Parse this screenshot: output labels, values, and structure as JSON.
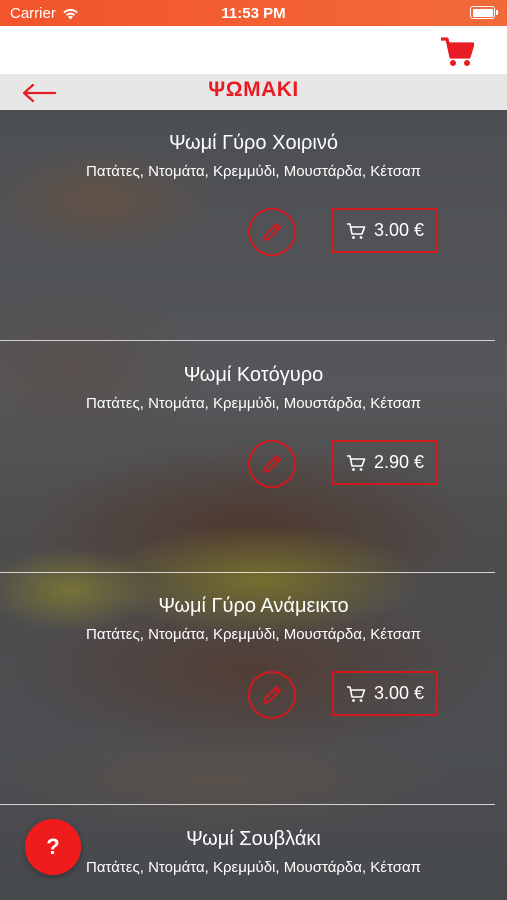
{
  "status_bar": {
    "carrier": "Carrier",
    "time": "11:53 PM",
    "battery_level": 1.0
  },
  "header": {
    "cart_icon": "shopping-cart-icon",
    "accent_color": "#e81c24"
  },
  "title_bar": {
    "back_icon": "arrow-left-icon",
    "title": "ΨΩΜΑΚΙ"
  },
  "products": [
    {
      "name": "Ψωμί Γύρο Χοιρινό",
      "description": "Πατάτες, Ντομάτα, Κρεμμύδι, Μουστάρδα, Κέτσαπ",
      "price": "3.00 €"
    },
    {
      "name": "Ψωμί Κοτόγυρο",
      "description": "Πατάτες, Ντομάτα, Κρεμμύδι, Μουστάρδα, Κέτσαπ",
      "price": "2.90 €"
    },
    {
      "name": "Ψωμί Γύρο Ανάμεικτο",
      "description": "Πατάτες, Ντομάτα, Κρεμμύδι, Μουστάρδα, Κέτσαπ",
      "price": "3.00 €"
    },
    {
      "name": "Ψωμί Σουβλάκι",
      "description": "Πατάτες, Ντομάτα, Κρεμμύδι, Μουστάρδα, Κέτσαπ"
    }
  ],
  "help_button": {
    "label": "?"
  }
}
